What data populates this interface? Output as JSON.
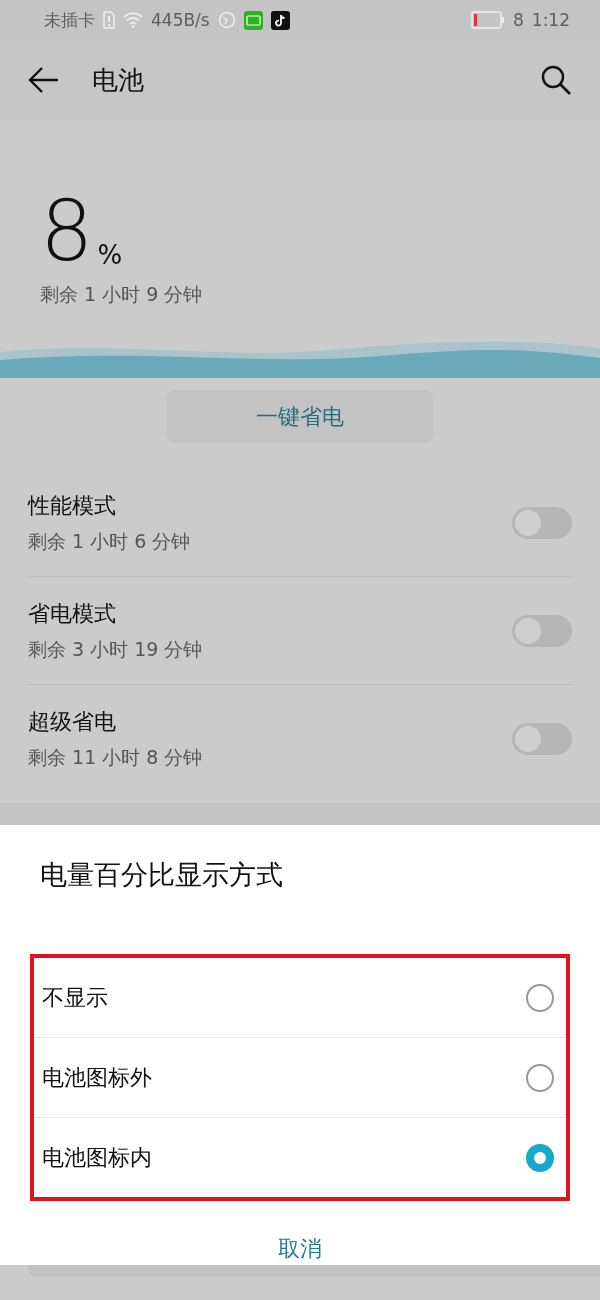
{
  "status_bar": {
    "carrier": "未插卡",
    "speed": "445B/s",
    "battery": "8",
    "time": "1:12"
  },
  "app_bar": {
    "title": "电池"
  },
  "summary": {
    "percent": "8",
    "unit": "%",
    "remaining": "剩余 1 小时 9 分钟"
  },
  "save_button": "一键省电",
  "modes": [
    {
      "title": "性能模式",
      "subtitle": "剩余 1 小时 6 分钟",
      "on": false
    },
    {
      "title": "省电模式",
      "subtitle": "剩余 3 小时 19 分钟",
      "on": false
    },
    {
      "title": "超级省电",
      "subtitle": "剩余 11 小时 8 分钟",
      "on": false
    }
  ],
  "dialog": {
    "title": "电量百分比显示方式",
    "options": [
      {
        "label": "不显示",
        "selected": false
      },
      {
        "label": "电池图标外",
        "selected": false
      },
      {
        "label": "电池图标内",
        "selected": true
      }
    ],
    "cancel": "取消"
  }
}
